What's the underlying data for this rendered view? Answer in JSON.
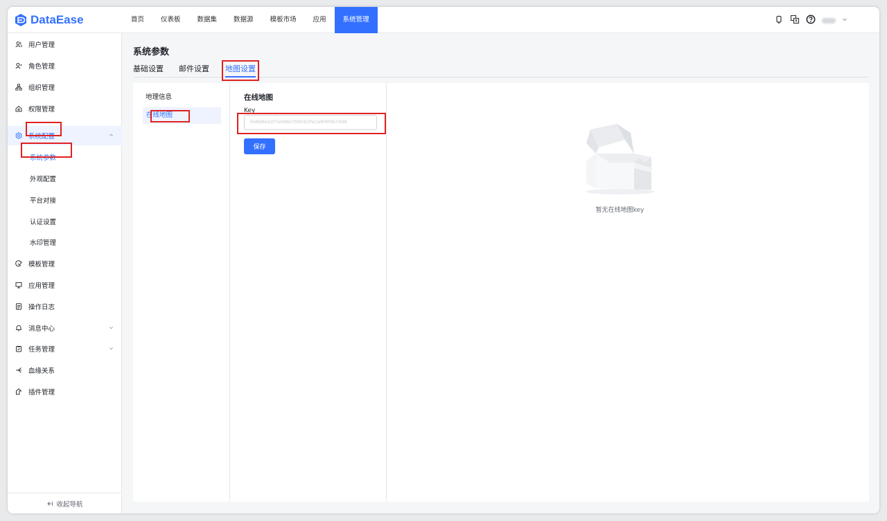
{
  "app": {
    "logo_text": "DataEase"
  },
  "header": {
    "nav": [
      {
        "label": "首页"
      },
      {
        "label": "仪表板"
      },
      {
        "label": "数据集"
      },
      {
        "label": "数据源"
      },
      {
        "label": "模板市场"
      },
      {
        "label": "应用"
      },
      {
        "label": "系统管理",
        "active": true
      }
    ],
    "tools": [
      "notification-icon",
      "translate-icon",
      "help-icon",
      "user-menu"
    ]
  },
  "sidebar": {
    "items": [
      {
        "label": "用户管理",
        "icon": "user-icon"
      },
      {
        "label": "角色管理",
        "icon": "role-icon"
      },
      {
        "label": "组织管理",
        "icon": "org-icon"
      },
      {
        "label": "权限管理",
        "icon": "permission-icon"
      },
      {
        "label": "系统配置",
        "icon": "settings-icon",
        "expanded": true
      },
      {
        "label": "模板管理",
        "icon": "template-icon"
      },
      {
        "label": "应用管理",
        "icon": "app-icon"
      },
      {
        "label": "操作日志",
        "icon": "log-icon"
      },
      {
        "label": "消息中心",
        "icon": "bell-icon",
        "has_children": true
      },
      {
        "label": "任务管理",
        "icon": "task-icon",
        "has_children": true
      },
      {
        "label": "血缘关系",
        "icon": "lineage-icon"
      },
      {
        "label": "插件管理",
        "icon": "plugin-icon"
      }
    ],
    "sub_items": [
      {
        "label": "系统参数",
        "active": true
      },
      {
        "label": "外观配置"
      },
      {
        "label": "平台对接"
      },
      {
        "label": "认证设置"
      },
      {
        "label": "水印管理"
      }
    ],
    "collapse_label": "收起导航"
  },
  "main": {
    "page_title": "系统参数",
    "tabs": [
      {
        "label": "基础设置"
      },
      {
        "label": "邮件设置"
      },
      {
        "label": "地图设置",
        "active": true
      }
    ],
    "map_menu": [
      {
        "label": "地理信息"
      },
      {
        "label": "在线地图",
        "active": true
      }
    ],
    "online_map": {
      "section_title": "在线地图",
      "key_label": "Key",
      "key_value": "0e6b8e42f7a9d6cf3bfcb2fe1a9f4f0b7dd9",
      "save_label": "保存"
    },
    "empty_text": "暂无在线地图key"
  },
  "colors": {
    "primary": "#3370ff",
    "annotation": "#e02020",
    "active_bg": "#eef3ff"
  }
}
